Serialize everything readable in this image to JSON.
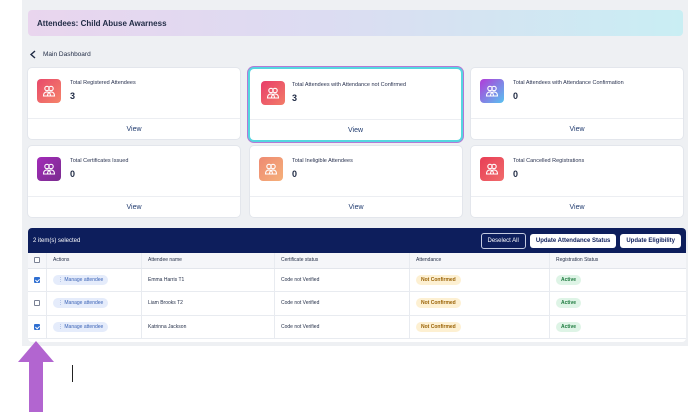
{
  "banner": {
    "title": "Attendees: Child Abuse Awarness"
  },
  "nav": {
    "back_label": "Main Dashboard"
  },
  "cards": [
    {
      "title": "Total Registered Attendees",
      "value": "3",
      "link": "View",
      "icon": "users-icon",
      "grad": [
        "#e8496a",
        "#f5846a"
      ]
    },
    {
      "title": "Total Attendees with Attendance not Confirmed",
      "value": "3",
      "link": "View",
      "icon": "users-icon",
      "grad": [
        "#e83d6a",
        "#f27c68"
      ]
    },
    {
      "title": "Total Attendees with Attendance Confirmation",
      "value": "0",
      "link": "View",
      "icon": "users-icon",
      "grad": [
        "#b23ad8",
        "#58c3f0"
      ]
    },
    {
      "title": "Total Certificates Issued",
      "value": "0",
      "link": "View",
      "icon": "users-icon",
      "grad": [
        "#a22bb8",
        "#7a2c8f"
      ]
    },
    {
      "title": "Total Ineligible Attendees",
      "value": "0",
      "link": "View",
      "icon": "users-icon",
      "grad": [
        "#ee8a72",
        "#f5b07a"
      ]
    },
    {
      "title": "Total Cancelled Registrations",
      "value": "0",
      "link": "View",
      "icon": "users-icon",
      "grad": [
        "#e83d55",
        "#f06c6c"
      ]
    }
  ],
  "table": {
    "selected_text": "2 item(s) selected",
    "deselect_label": "Deselect All",
    "update_status_label": "Update Attendance Status",
    "update_eligibility_label": "Update Eligibility",
    "headers": [
      "Actions",
      "Attendee name",
      "Certificate status",
      "Attendance",
      "Registration Status"
    ],
    "rows": [
      {
        "checked": true,
        "action": "Manage attendee",
        "name": "Emma Harris T1",
        "certificate": "Code not Verified",
        "attendance": "Not Confirmed",
        "registration": "Active"
      },
      {
        "checked": false,
        "action": "Manage attendee",
        "name": "Liam Brooks T2",
        "certificate": "Code not Verified",
        "attendance": "Not Confirmed",
        "registration": "Active"
      },
      {
        "checked": true,
        "action": "Manage attendee",
        "name": "Katrinna Jackson",
        "certificate": "Code not Verified",
        "attendance": "Not Confirmed",
        "registration": "Active"
      }
    ]
  },
  "colors": {
    "navy": "#0d1e5c",
    "arrow": "#b265d0"
  }
}
